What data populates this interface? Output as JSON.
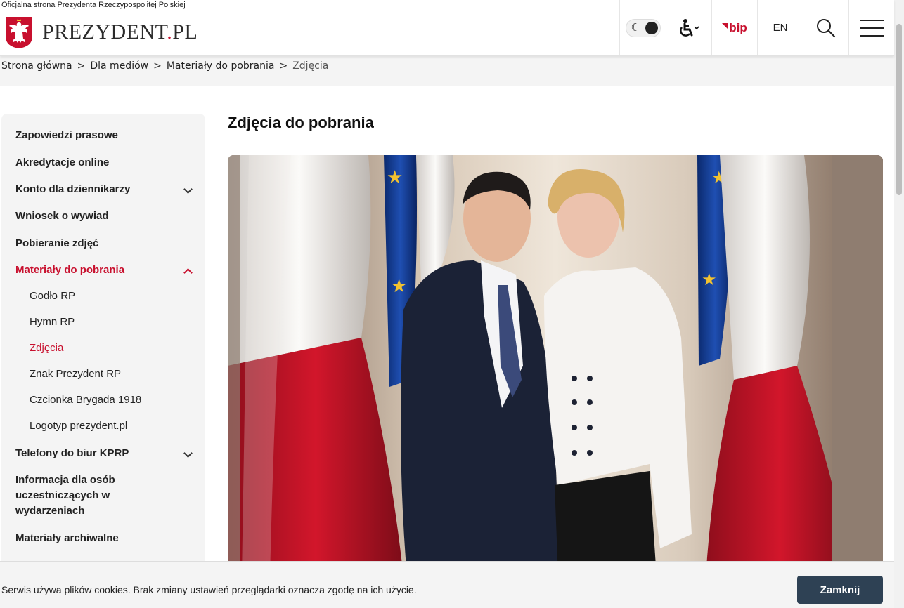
{
  "header": {
    "tagline": "Oficjalna strona Prezydenta Rzeczypospolitej Polskiej",
    "brand_main": "PREZYDENT",
    "brand_dot": ".",
    "brand_tld": "PL",
    "buttons": {
      "theme_toggle": "moon-toggle",
      "accessibility": "accessibility-icon",
      "bip": "bip",
      "lang": "EN",
      "search": "search-icon",
      "menu": "hamburger-menu-icon"
    },
    "accent_color": "#c8102e"
  },
  "breadcrumb": {
    "items": [
      "Strona główna",
      "Dla mediów",
      "Materiały do pobrania"
    ],
    "current": "Zdjęcia",
    "separator": ">"
  },
  "sidebar": {
    "items": [
      {
        "label": "Zapowiedzi prasowe"
      },
      {
        "label": "Akredytacje online"
      },
      {
        "label": "Konto dla dziennikarzy",
        "expandable": true
      },
      {
        "label": "Wniosek o wywiad"
      },
      {
        "label": "Pobieranie zdjęć"
      },
      {
        "label": "Materiały do pobrania",
        "expandable": true,
        "expanded": true,
        "active": true
      },
      {
        "label": "Telefony do biur KPRP",
        "expandable": true
      },
      {
        "label": "Informacja dla osób uczestniczących w wydarzeniach"
      },
      {
        "label": "Materiały archiwalne"
      }
    ],
    "subitems": [
      {
        "label": "Godło RP"
      },
      {
        "label": "Hymn RP"
      },
      {
        "label": "Zdjęcia",
        "active": true
      },
      {
        "label": "Znak Prezydent RP"
      },
      {
        "label": "Czcionka Brygada 1918"
      },
      {
        "label": "Logotyp prezydent.pl"
      }
    ]
  },
  "main": {
    "title": "Zdjęcia do pobrania",
    "photo": "official-portrait-photo"
  },
  "cookie": {
    "text": "Serwis używa plików cookies. Brak zmiany ustawień przeglądarki oznacza zgodę na ich użycie.",
    "button": "Zamknij",
    "button_color": "#2e4154"
  }
}
